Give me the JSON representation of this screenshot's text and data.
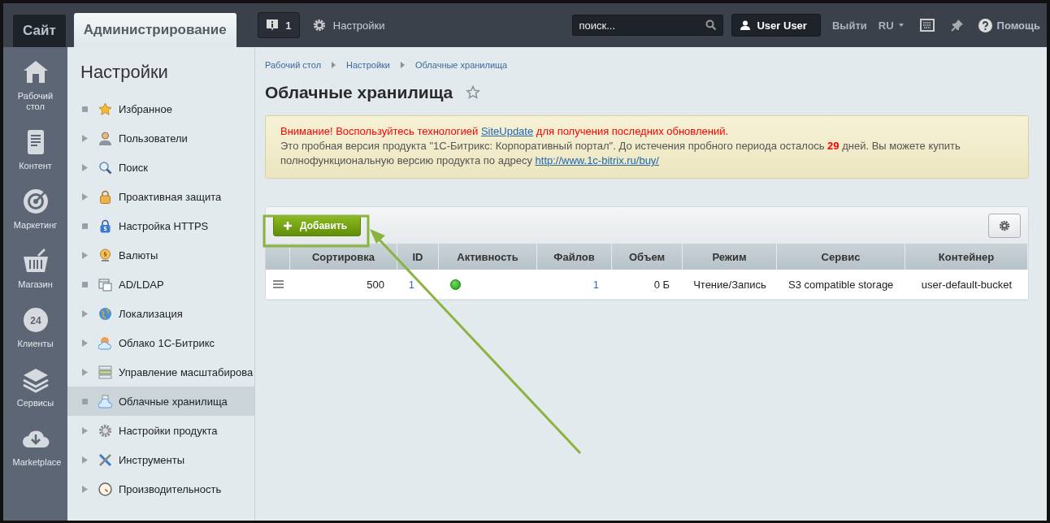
{
  "header": {
    "tabs": [
      {
        "label": "Сайт",
        "selected": false
      },
      {
        "label": "Администрирование",
        "selected": true
      }
    ],
    "notifications": "1",
    "settings": "Настройки",
    "search": {
      "placeholder": "поиск..."
    },
    "user": "User User",
    "logout": "Выйти",
    "language": "RU",
    "help": "Помощь"
  },
  "main_nav": [
    {
      "label": "Рабочий стол",
      "kind": "home"
    },
    {
      "label": "Контент",
      "kind": "document"
    },
    {
      "label": "Маркетинг",
      "kind": "target"
    },
    {
      "label": "Магазин",
      "kind": "basket"
    },
    {
      "label": "Клиенты",
      "kind": "cloud24",
      "icon_text": "24"
    },
    {
      "label": "Сервисы",
      "kind": "layers"
    },
    {
      "label": "Marketplace",
      "kind": "download"
    }
  ],
  "sidebar": {
    "title": "Настройки",
    "items": [
      {
        "label": "Избранное",
        "kind": "star",
        "expandable": false,
        "selected": false
      },
      {
        "label": "Пользователи",
        "kind": "user",
        "expandable": true,
        "selected": false
      },
      {
        "label": "Поиск",
        "kind": "search",
        "expandable": true,
        "selected": false
      },
      {
        "label": "Проактивная защита",
        "kind": "lock",
        "expandable": true,
        "selected": false
      },
      {
        "label": "Настройка HTTPS",
        "kind": "https",
        "expandable": false,
        "selected": false
      },
      {
        "label": "Валюты",
        "kind": "coin",
        "expandable": true,
        "selected": false
      },
      {
        "label": "AD/LDAP",
        "kind": "ldap",
        "expandable": false,
        "selected": false
      },
      {
        "label": "Локализация",
        "kind": "globe",
        "expandable": true,
        "selected": false
      },
      {
        "label": "Облако 1С-Битрикс",
        "kind": "cloudb",
        "expandable": true,
        "selected": false
      },
      {
        "label": "Управление масштабирова",
        "kind": "servers",
        "expandable": true,
        "selected": false
      },
      {
        "label": "Облачные хранилища",
        "kind": "cloud",
        "expandable": false,
        "selected": true
      },
      {
        "label": "Настройки продукта",
        "kind": "gear",
        "expandable": true,
        "selected": false
      },
      {
        "label": "Инструменты",
        "kind": "tools",
        "expandable": true,
        "selected": false
      },
      {
        "label": "Производительность",
        "kind": "gauge",
        "expandable": true,
        "selected": false
      }
    ]
  },
  "breadcrumbs": [
    "Рабочий стол",
    "Настройки",
    "Облачные хранилища"
  ],
  "page_title": "Облачные хранилища",
  "notice": {
    "warning_before": "Внимание! Воспользуйтесь технологией",
    "warning_link": "SiteUpdate",
    "warning_after": "для получения последних обновлений.",
    "text_before": "Это пробная версия продукта \"1С-Битрикс: Корпоративный портал\". До истечения пробного периода осталось",
    "days": "29",
    "text_after": "дней. Вы можете купить полнофункциональную версию продукта по адресу",
    "link": "http://www.1c-bitrix.ru/buy/"
  },
  "table": {
    "add_button": "Добавить",
    "columns": [
      "Сортировка",
      "ID",
      "Активность",
      "Файлов",
      "Объем",
      "Режим",
      "Сервис",
      "Контейнер"
    ],
    "rows": [
      {
        "sort": "500",
        "id": "1",
        "active": true,
        "files": "1",
        "size": "0 Б",
        "mode": "Чтение/Запись",
        "service": "S3 compatible storage",
        "container": "user-default-bucket"
      }
    ]
  }
}
